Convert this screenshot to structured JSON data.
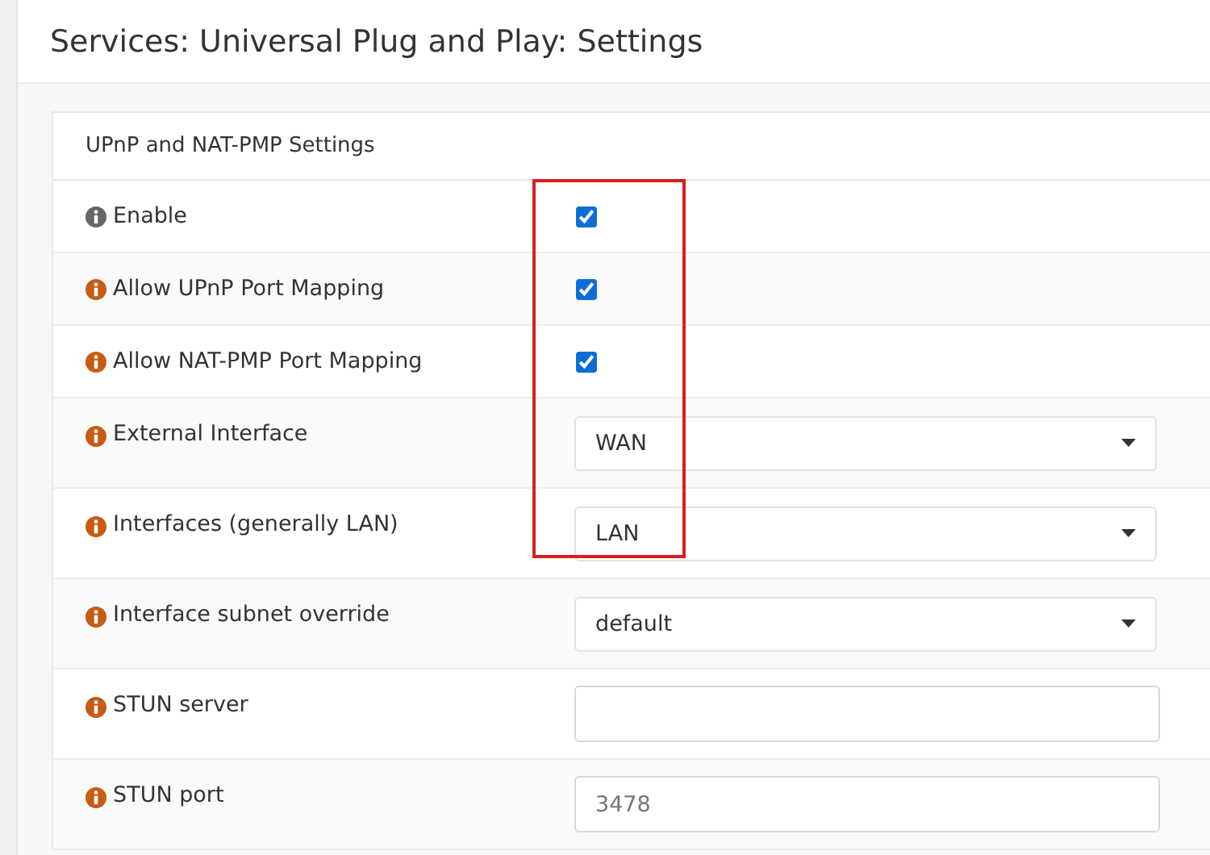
{
  "page_title": "Services: Universal Plug and Play: Settings",
  "section": {
    "title": "UPnP and NAT-PMP Settings",
    "rows": [
      {
        "kind": "checkbox",
        "label": "Enable",
        "color": "#666666",
        "checked": true
      },
      {
        "kind": "checkbox",
        "label": "Allow UPnP Port Mapping",
        "color": "#c75b12",
        "checked": true
      },
      {
        "kind": "checkbox",
        "label": "Allow NAT-PMP Port Mapping",
        "color": "#c75b12",
        "checked": true
      },
      {
        "kind": "select",
        "label": "External Interface",
        "color": "#c75b12",
        "value": "WAN"
      },
      {
        "kind": "select",
        "label": "Interfaces (generally LAN)",
        "color": "#c75b12",
        "value": "LAN"
      },
      {
        "kind": "select",
        "label": "Interface subnet override",
        "color": "#c75b12",
        "value": "default"
      },
      {
        "kind": "text",
        "label": "STUN server",
        "color": "#c75b12"
      },
      {
        "kind": "text",
        "label": "STUN port",
        "color": "#c75b12",
        "placeholder": "3478"
      }
    ]
  }
}
